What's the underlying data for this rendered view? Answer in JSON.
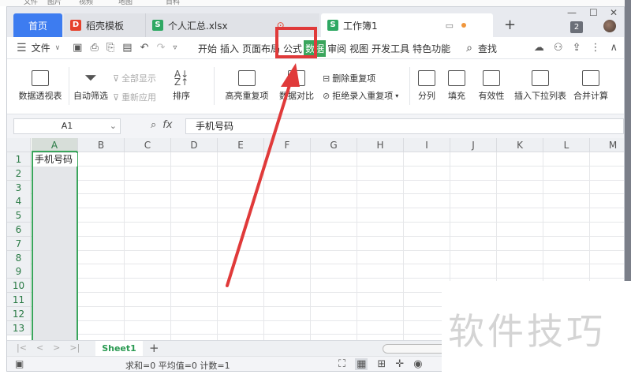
{
  "tabs": {
    "home": "首页",
    "doc": "稻壳模板",
    "xlsx": "个人汇总.xlsx",
    "active": "工作簿1",
    "badge": "2"
  },
  "menu": {
    "file": "文件",
    "items": [
      "开始",
      "插入",
      "页面布局",
      "公式",
      "数据",
      "审阅",
      "视图",
      "开发工具",
      "特色功能"
    ],
    "search": "查找"
  },
  "ribbon": {
    "pivot": "数据透视表",
    "autofilter": "自动筛选",
    "showall": "全部显示",
    "reapply": "重新应用",
    "sort": "排序",
    "highlight_dup": "高亮重复项",
    "compare": "数据对比",
    "delete_dup": "删除重复项",
    "reject_dup": "拒绝录入重复项",
    "split": "分列",
    "fill": "填充",
    "validity": "有效性",
    "insert_dropdown": "插入下拉列表",
    "merge_calc": "合并计算"
  },
  "formula_bar": {
    "cell_ref": "A1",
    "fx": "fx",
    "content": "手机号码"
  },
  "grid": {
    "columns": [
      "A",
      "B",
      "C",
      "D",
      "E",
      "F",
      "G",
      "H",
      "I",
      "J",
      "K",
      "L",
      "M"
    ],
    "rows": [
      "1",
      "2",
      "3",
      "4",
      "5",
      "6",
      "7",
      "8",
      "9",
      "10",
      "11",
      "12",
      "13"
    ],
    "a1": "手机号码"
  },
  "sheet": {
    "name": "Sheet1"
  },
  "status": {
    "text": "求和=0  平均值=0  计数=1"
  },
  "watermark": "软件技巧",
  "colors": {
    "accent_green": "#3aa55c",
    "home_tab_blue": "#3d7cf0",
    "annotation_red": "#e03a3a"
  }
}
